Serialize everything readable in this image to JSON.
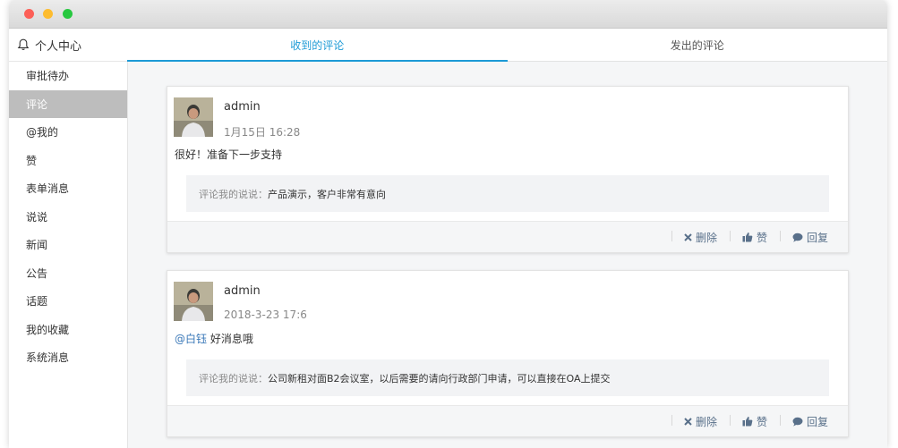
{
  "window": {
    "traffic_lights": [
      "close",
      "minimize",
      "maximize"
    ]
  },
  "sidebar": {
    "title": "个人中心",
    "title_icon": "bell-icon",
    "items": [
      {
        "label": "审批待办",
        "active": false
      },
      {
        "label": "评论",
        "active": true
      },
      {
        "label": "@我的",
        "active": false
      },
      {
        "label": "赞",
        "active": false
      },
      {
        "label": "表单消息",
        "active": false
      },
      {
        "label": "说说",
        "active": false
      },
      {
        "label": "新闻",
        "active": false
      },
      {
        "label": "公告",
        "active": false
      },
      {
        "label": "话题",
        "active": false
      },
      {
        "label": "我的收藏",
        "active": false
      },
      {
        "label": "系统消息",
        "active": false
      }
    ]
  },
  "tabs": [
    {
      "label": "收到的评论",
      "active": true
    },
    {
      "label": "发出的评论",
      "active": false
    }
  ],
  "comments": [
    {
      "author": "admin",
      "time": "1月15日 16:28",
      "mention": "",
      "text": "很好！准备下一步支持",
      "quote_label": "评论我的说说：",
      "quote_text": "产品演示，客户非常有意向",
      "actions": {
        "delete": "删除",
        "like": "赞",
        "reply": "回复"
      }
    },
    {
      "author": "admin",
      "time": "2018-3-23 17:6",
      "mention": "@白钰",
      "text": " 好消息哦",
      "quote_label": "评论我的说说：",
      "quote_text": "公司新租对面B2会议室，以后需要的请向行政部门申请，可以直接在OA上提交",
      "actions": {
        "delete": "删除",
        "like": "赞",
        "reply": "回复"
      }
    }
  ],
  "colors": {
    "accent": "#1c9ad6",
    "active_sidebar": "#bdbdbd",
    "action_text": "#59708a"
  }
}
